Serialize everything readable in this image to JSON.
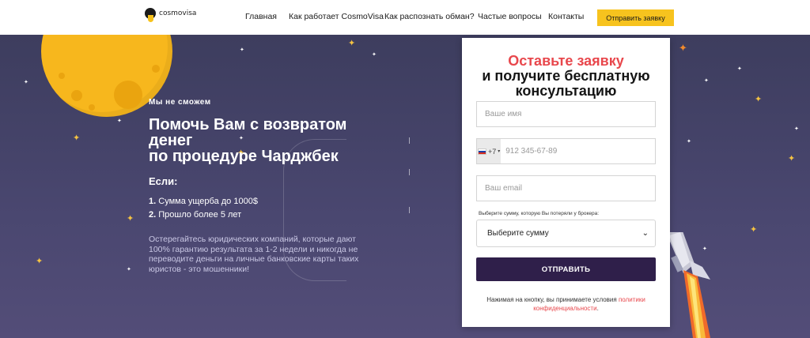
{
  "header": {
    "logo_text": "cosmovisa",
    "nav": [
      {
        "label": "Главная"
      },
      {
        "label": "Как работает CosmoVisa"
      },
      {
        "label": "Как распознать обман?"
      },
      {
        "label": "Частые вопросы"
      },
      {
        "label": "Контакты"
      }
    ],
    "cta_label": "Отправить заявку"
  },
  "hero": {
    "kicker": "Мы не сможем",
    "headline": [
      "Помочь Вам с возвратом",
      "денег",
      "по процедуре Чарджбек"
    ],
    "if_label": "Если:",
    "conditions": [
      {
        "num": "1.",
        "text": "Сумма ущерба до 1000$"
      },
      {
        "num": "2.",
        "text": "Прошло более 5 лет"
      }
    ],
    "warning": "Остерегайтесь юридических компаний, которые дают 100% гарантию результата за 1-2 недели и никогда не переводите деньги на личные банковские карты таких юристов - это мошенники!"
  },
  "form": {
    "title_accent": "Оставьте заявку",
    "title_line2": "и получите бесплатную",
    "title_line3": "консультацию",
    "name_placeholder": "Ваше имя",
    "phone_code": "+7",
    "phone_placeholder": "912 345-67-89",
    "email_placeholder": "Ваш email",
    "sum_label": "Выберите сумму, которую Вы потеряли у брокера:",
    "sum_selected": "Выберите сумму",
    "submit_label": "ОТПРАВИТЬ",
    "agree_text": "Нажимая на кнопку, вы принимаете условия",
    "agree_link": "политики конфиденциальности",
    "agree_end": "."
  },
  "colors": {
    "accent_red": "#e8474c",
    "brand_yellow": "#f7c31e",
    "submit_bg": "#2f1f4a",
    "hero_bg": "#45426a"
  }
}
